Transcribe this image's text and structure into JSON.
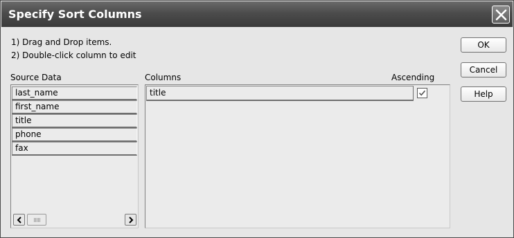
{
  "window": {
    "title": "Specify Sort Columns"
  },
  "instructions": [
    "1) Drag and Drop items.",
    "2) Double-click column to edit"
  ],
  "source": {
    "label": "Source Data",
    "items": [
      "last_name",
      "first_name",
      "title",
      "phone",
      "fax"
    ]
  },
  "columns": {
    "label": "Columns",
    "ascending_label": "Ascending",
    "rows": [
      {
        "name": "title",
        "ascending": true
      }
    ]
  },
  "buttons": {
    "ok": "OK",
    "cancel": "Cancel",
    "help": "Help"
  },
  "icons": {
    "close": "close-icon",
    "checkmark": "checkmark-icon",
    "scroll_left": "arrow-left-icon",
    "scroll_right": "arrow-right-icon"
  }
}
